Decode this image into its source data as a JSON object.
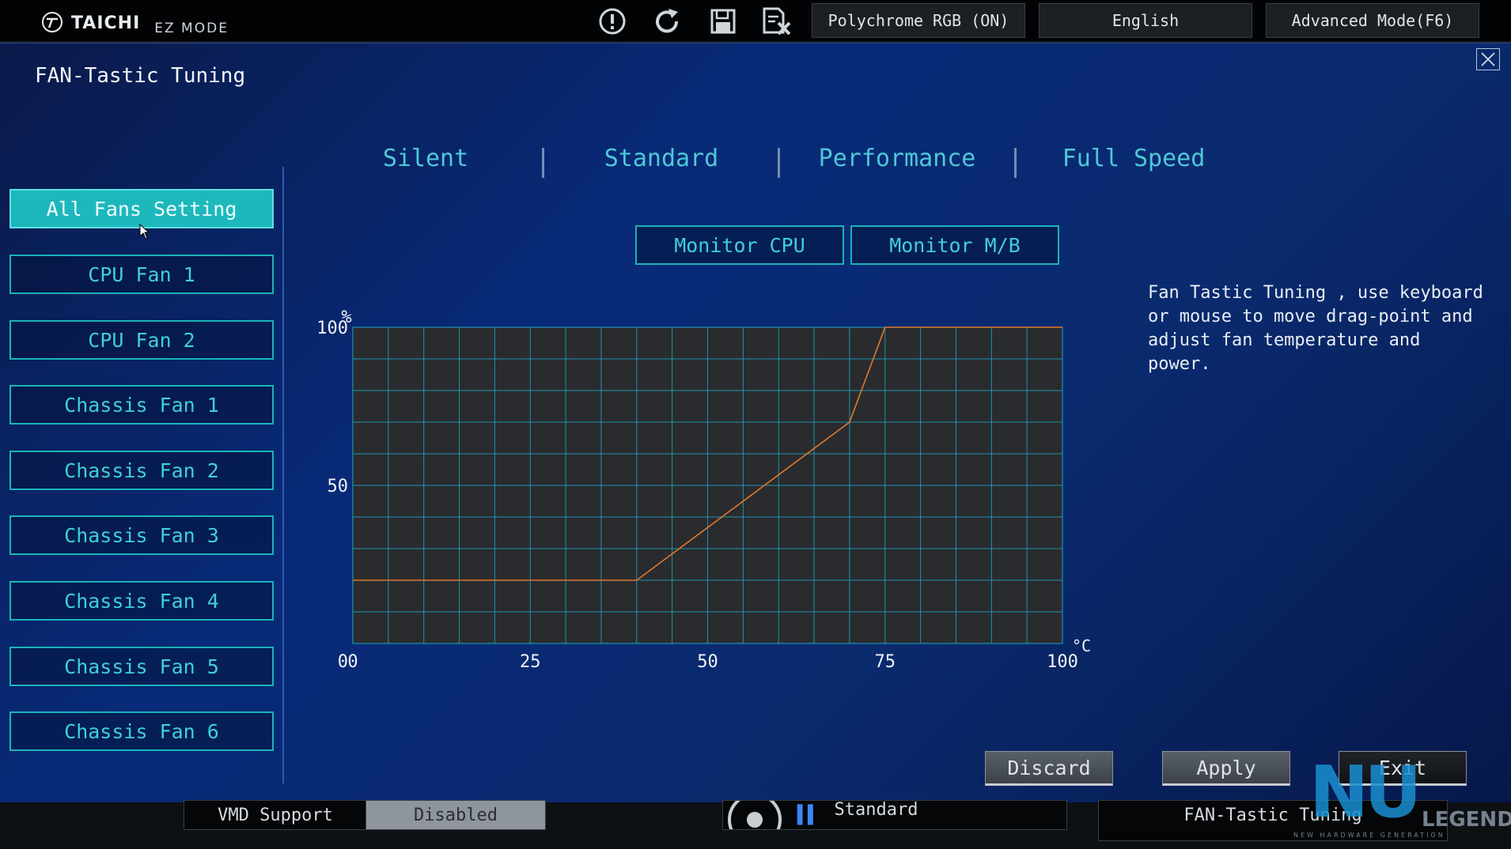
{
  "header": {
    "brand": "TAICHI",
    "mode": "EZ MODE",
    "icons": [
      "warning-icon",
      "refresh-icon",
      "save-icon",
      "discard-file-icon"
    ],
    "polychrome_label": "Polychrome RGB (ON)",
    "language_label": "English",
    "advanced_label": "Advanced Mode(F6)"
  },
  "panel": {
    "title": "FAN-Tastic Tuning",
    "fan_buttons": [
      "All Fans Setting",
      "CPU Fan 1",
      "CPU Fan 2",
      "Chassis Fan 1",
      "Chassis Fan 2",
      "Chassis Fan 3",
      "Chassis Fan 4",
      "Chassis Fan 5",
      "Chassis Fan 6"
    ],
    "active_fan": "All Fans Setting",
    "presets": [
      "Silent",
      "Standard",
      "Performance",
      "Full Speed"
    ],
    "monitor_cpu": "Monitor CPU",
    "monitor_mb": "Monitor M/B",
    "help_text": "Fan Tastic Tuning , use keyboard\nor mouse to move drag-point and\nadjust fan temperature and power.",
    "actions": {
      "discard": "Discard",
      "apply": "Apply",
      "exit": "Exit"
    }
  },
  "chart_data": {
    "type": "line",
    "x": [
      0,
      40,
      70,
      75,
      100
    ],
    "y": [
      20,
      20,
      70,
      100,
      100
    ],
    "xlabel": "°C",
    "ylabel": "%",
    "xlim": [
      0,
      100
    ],
    "ylim": [
      0,
      100
    ],
    "x_ticks": [
      "0",
      "25",
      "50",
      "75",
      "100"
    ],
    "y_ticks": [
      "0",
      "50",
      "100"
    ],
    "grid": true,
    "line_color": "#e07a2c",
    "grid_color": "#1aa8c4"
  },
  "background": {
    "vmd_label": "VMD Support",
    "vmd_value": "Disabled",
    "fan_mode": "Standard",
    "fan_tuning": "FAN-Tastic Tuning"
  },
  "watermark": {
    "mark": "NU",
    "legend": "LEGEND",
    "tagline": "NEW HARDWARE GENERATION"
  },
  "colors": {
    "accent": "#1db8bc",
    "panel": "#082a78"
  }
}
